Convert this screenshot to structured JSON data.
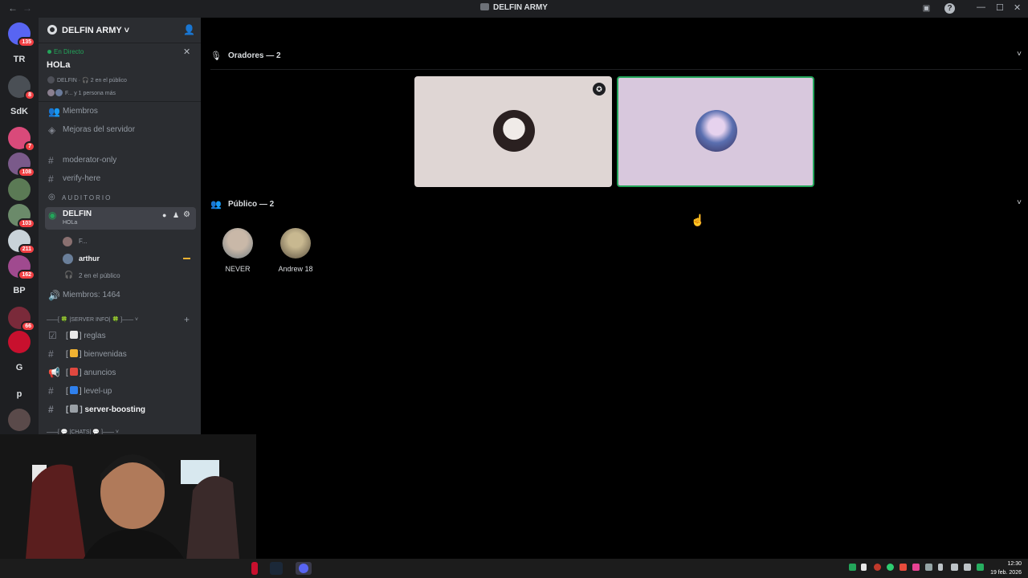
{
  "window": {
    "title": "DELFIN ARMY"
  },
  "guilds": [
    {
      "label": "",
      "badge": "135",
      "color": "#5865f2"
    },
    {
      "label": "TR",
      "badge": ""
    },
    {
      "label": "",
      "badge": "8",
      "color": "#4a4f55"
    },
    {
      "label": "SdK",
      "badge": ""
    },
    {
      "label": "",
      "badge": "7",
      "color": "#d94a7a"
    },
    {
      "label": "",
      "badge": "108",
      "color": "#7a5a8a"
    },
    {
      "label": "",
      "badge": "",
      "color": "#5b7a55"
    },
    {
      "label": "",
      "badge": "103",
      "color": "#6b8a6a"
    },
    {
      "label": "",
      "badge": "211",
      "color": "#c9d3d9"
    },
    {
      "label": "",
      "badge": "162",
      "color": "#a04a8f"
    },
    {
      "label": "BP",
      "badge": ""
    },
    {
      "label": "",
      "badge": "66",
      "color": "#7a2a3a"
    },
    {
      "label": "",
      "badge": "",
      "color": "#c8102e"
    },
    {
      "label": "G",
      "badge": ""
    },
    {
      "label": "p",
      "badge": ""
    },
    {
      "label": "",
      "badge": "",
      "color": "#5a4a4a"
    }
  ],
  "server": {
    "name": "DELFIN ARMY",
    "live": {
      "status": "En Directo",
      "topic": "HOLa",
      "meta": "DELFIN · 🎧 2 en el público",
      "listeners": "F... y 1 persona más"
    },
    "members_link": "Miembros",
    "boosts_link": "Mejoras del servidor",
    "channels_top": [
      "moderator-only",
      "verify-here"
    ],
    "category_auditorio": "AUDITORIO",
    "stage": {
      "name": "DELFIN",
      "topic": "HOLa",
      "speakers": [
        "F...",
        "arthur"
      ],
      "audience": "2 en el público",
      "members_count": "Miembros: 1464"
    },
    "category_info": "——[ 🍀 |SERVER INFO| 🍀 ]——",
    "info_channels": [
      {
        "name": "reglas",
        "emoji_color": "#e8e8e8"
      },
      {
        "name": "bienvenidas",
        "emoji_color": "#f0b232"
      },
      {
        "name": "anuncios",
        "emoji_color": "#e0483f"
      },
      {
        "name": "level-up",
        "emoji_color": "#2f80ed"
      },
      {
        "name": "server-boosting",
        "emoji_color": "#9aa0a6"
      }
    ],
    "category_chats": "——[ 💬 |CHATS| 💬 ]——"
  },
  "stage_view": {
    "speakers_header": "Oradores — 2",
    "audience_header": "Público — 2",
    "speakers": [
      {
        "tile_color": "#dfd6d4"
      },
      {
        "tile_color": "#d8c8dd",
        "speaking": true
      }
    ],
    "audience": [
      {
        "name": "NEVER"
      },
      {
        "name": "Andrew 18"
      }
    ]
  },
  "taskbar": {
    "time": "12:30",
    "date": "19 feb. 2026"
  }
}
